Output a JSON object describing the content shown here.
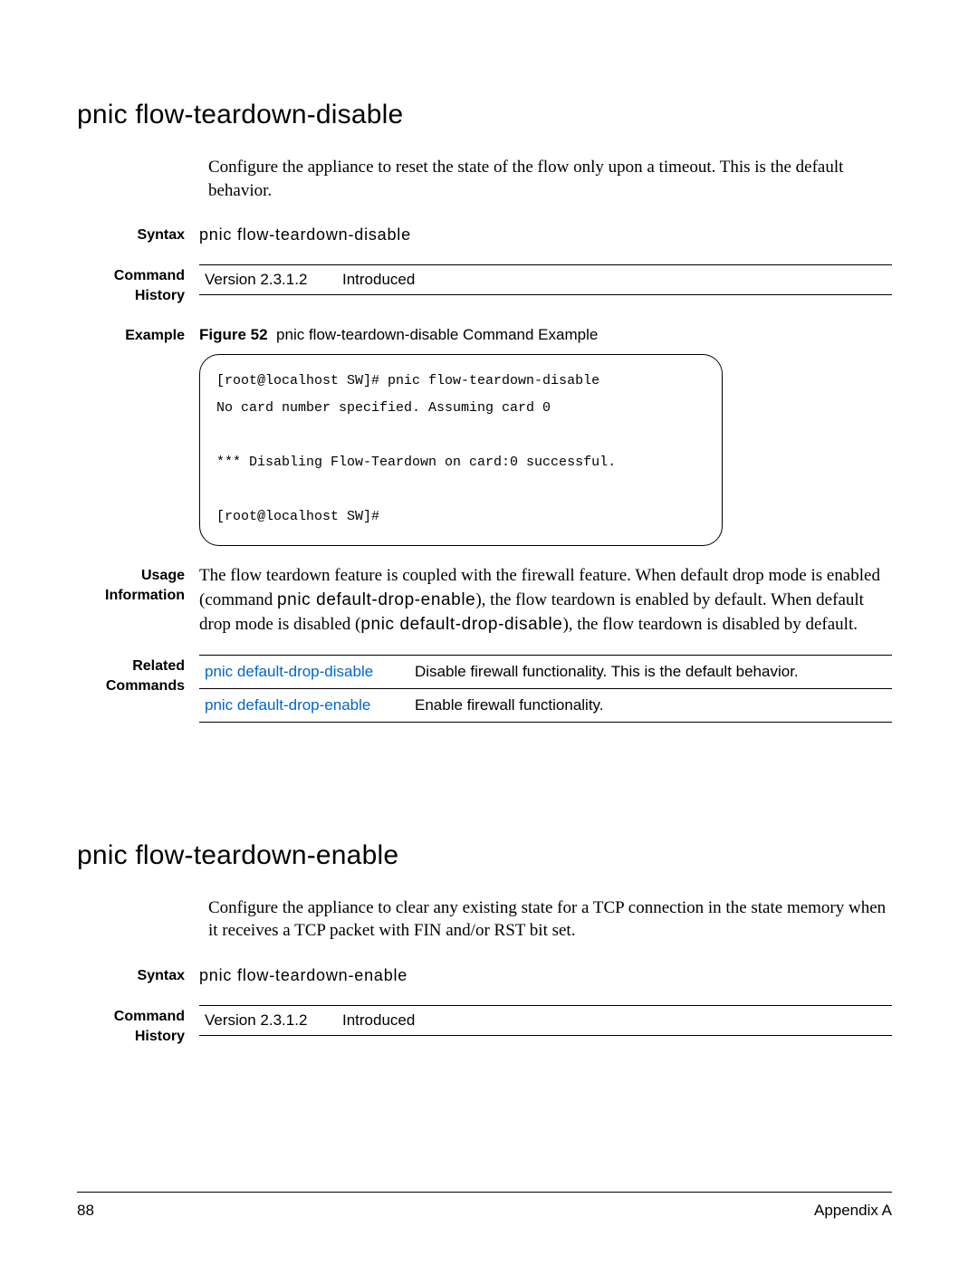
{
  "section1": {
    "title": "pnic flow-teardown-disable",
    "intro": "Configure the appliance to reset the state of the flow only upon a timeout. This is the default behavior.",
    "syntax_label": "Syntax",
    "syntax_text": "pnic flow-teardown-disable",
    "history_label": "Command History",
    "history_version": "Version 2.3.1.2",
    "history_status": "Introduced",
    "example_label": "Example",
    "figure_label": "Figure 52",
    "figure_caption": "pnic flow-teardown-disable Command Example",
    "code": "[root@localhost SW]# pnic flow-teardown-disable\nNo card number specified. Assuming card 0\n\n*** Disabling Flow-Teardown on card:0 successful.\n\n[root@localhost SW]#",
    "usage_label": "Usage Information",
    "usage_pre": "The flow teardown feature is coupled with the firewall feature. When default drop mode is enabled (command ",
    "usage_cmd1": "pnic default-drop-enable",
    "usage_mid": "), the flow teardown is enabled by default. When default drop mode is disabled (",
    "usage_cmd2": "pnic default-drop-disable",
    "usage_post": "), the flow teardown is disabled by default.",
    "related_label": "Related Commands",
    "related": [
      {
        "cmd": "pnic default-drop-disable",
        "desc": "Disable firewall functionality. This is the default behavior."
      },
      {
        "cmd": "pnic default-drop-enable",
        "desc": "Enable firewall functionality."
      }
    ]
  },
  "section2": {
    "title": "pnic flow-teardown-enable",
    "intro": "Configure the appliance to clear any existing state for a TCP connection in the state memory when it receives a TCP packet with FIN and/or RST bit set.",
    "syntax_label": "Syntax",
    "syntax_text": "pnic flow-teardown-enable",
    "history_label": "Command History",
    "history_version": "Version 2.3.1.2",
    "history_status": "Introduced"
  },
  "footer": {
    "page": "88",
    "appendix": "Appendix A"
  }
}
